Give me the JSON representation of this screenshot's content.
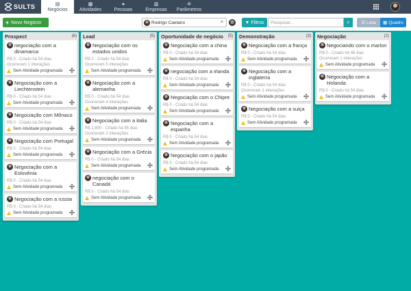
{
  "app": {
    "brand": "SULTS"
  },
  "nav": {
    "items": [
      {
        "label": "Negócios",
        "icon": "briefcase-icon",
        "active": true
      },
      {
        "label": "Atividades",
        "icon": "calendar-icon"
      },
      {
        "label": "Pessoas",
        "icon": "person-icon"
      },
      {
        "label": "Empresas",
        "icon": "building-icon"
      },
      {
        "label": "Parâmetros",
        "icon": "gears-icon"
      }
    ]
  },
  "toolbar": {
    "new_label": "Novo Negócio",
    "user": "Rodrigo Caetano",
    "filter_label": "Filtros",
    "search_placeholder": "Pesquisar...",
    "lista_label": "Lista",
    "quadro_label": "Quadro"
  },
  "columns": [
    {
      "title": "Prospect",
      "count": "(6)",
      "cards": [
        {
          "title": "negociação com a dinamarca",
          "meta": "R$ 0 - Criado há 54 dias",
          "extra": "Ocorreram 1 interações",
          "activity": "Sem Atividade programada"
        },
        {
          "title": "Negociação com a Liechtenstein",
          "meta": "R$ 0 - Criado há 54 dias",
          "activity": "Sem Atividade programada"
        },
        {
          "title": "Negociação com Mônaco",
          "meta": "R$ 0 - Criado há 54 dias",
          "activity": "Sem Atividade programada"
        },
        {
          "title": "Negociação com Portugal",
          "meta": "R$ 0 - Criado há 54 dias",
          "activity": "Sem Atividade programada"
        },
        {
          "title": "Negociação com a Eslovênia",
          "meta": "R$ 0 - Criado há 54 dias",
          "activity": "Sem Atividade programada"
        },
        {
          "title": "Negociação com a russia",
          "meta": "R$ 0 - Criado há 54 dias",
          "activity": "Sem Atividade programada"
        }
      ]
    },
    {
      "title": "Lead",
      "count": "(5)",
      "cards": [
        {
          "title": "Negociação com os estados unidos",
          "meta": "R$ 0 - Criado há 54 dias",
          "extra": "Ocorreram 5 interações",
          "activity": "Sem Atividade programada"
        },
        {
          "title": "Negociação com a alemanha",
          "meta": "R$ 0 - Criado há 54 dias",
          "extra": "Ocorreram 4 interações",
          "activity": "Sem Atividade programada"
        },
        {
          "title": "Negociação com a italia",
          "meta": "R$ 1.800 - Criado há 95 dias",
          "extra": "Ocorreram 2 interações",
          "activity": "Sem Atividade programada"
        },
        {
          "title": "Negociação com a Grécia",
          "meta": "R$ 0 - Criado há 54 dias",
          "activity": "Sem Atividade programada"
        },
        {
          "title": "negociação com o Canadá",
          "meta": "R$ 0 - Criado há 54 dias",
          "activity": "Sem Atividade programada"
        }
      ]
    },
    {
      "title": "Oportunidade de negócio",
      "count": "(5)",
      "cards": [
        {
          "title": "Negociação com a china",
          "meta": "R$ 0 - Criado há 54 dias",
          "activity": "Sem Atividade programada"
        },
        {
          "title": "negociação com a irlanda",
          "meta": "R$ 0 - Criado há 54 dias",
          "activity": "Sem Atividade programada"
        },
        {
          "title": "Negociação com o Chipre",
          "meta": "R$ 0 - Criado há 54 dias",
          "activity": "Sem Atividade programada"
        },
        {
          "title": "Negociação com a espanha",
          "meta": "R$ 0 - Criado há 54 dias",
          "activity": "Sem Atividade programada"
        },
        {
          "title": "Negociação com o japão",
          "meta": "R$ 0 - Criado há 54 dias",
          "activity": "Sem Atividade programada"
        }
      ]
    },
    {
      "title": "Demonstração",
      "count": "(3)",
      "cards": [
        {
          "title": "Negociação com a frança",
          "meta": "R$ 0 - Criado há 54 dias",
          "activity": "Sem Atividade programada"
        },
        {
          "title": "Negociação com a inglaterra",
          "meta": "R$ 0 - Criado há 54 dias",
          "extra": "Ocorreram 1 interações",
          "activity": "Sem Atividade programada"
        },
        {
          "title": "Negociação com a suiça",
          "meta": "R$ 0 - Criado há 54 dias",
          "activity": "Sem Atividade programada"
        }
      ]
    },
    {
      "title": "Negociação",
      "count": "(2)",
      "cards": [
        {
          "title": "Negociando com o marlon",
          "meta": "R$ 0 - Criado há 48 dias",
          "extra": "Ocorreram 1 interações",
          "activity": "Sem Atividade programada"
        },
        {
          "title": "Negociação com a Holanda",
          "meta": "R$ 0 - Criado há 54 dias",
          "activity": "Sem Atividade programada"
        }
      ]
    }
  ]
}
